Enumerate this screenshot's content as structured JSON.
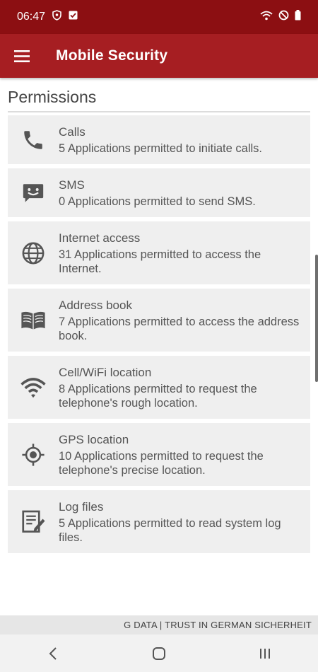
{
  "status_bar": {
    "time": "06:47",
    "icons": [
      "shield-icon",
      "checkbox-icon",
      "wifi-icon",
      "do-not-disturb-icon",
      "battery-icon"
    ]
  },
  "app_bar": {
    "title": "Mobile Security",
    "menu_icon": "hamburger-menu-icon"
  },
  "section": {
    "title": "Permissions"
  },
  "permissions": [
    {
      "icon": "phone-icon",
      "title": "Calls",
      "description": "5 Applications permitted to initiate calls."
    },
    {
      "icon": "sms-icon",
      "title": "SMS",
      "description": "0 Applications permitted to send SMS."
    },
    {
      "icon": "globe-icon",
      "title": "Internet access",
      "description": "31 Applications permitted to access the Internet."
    },
    {
      "icon": "book-icon",
      "title": "Address book",
      "description": "7 Applications permitted to access the address book."
    },
    {
      "icon": "wifi-icon",
      "title": "Cell/WiFi location",
      "description": "8 Applications permitted to request the telephone's rough location."
    },
    {
      "icon": "gps-target-icon",
      "title": "GPS location",
      "description": "10 Applications permitted to request the telephone's precise location."
    },
    {
      "icon": "log-file-icon",
      "title": "Log files",
      "description": "5 Applications permitted to read system log files."
    }
  ],
  "footer": {
    "text": "G DATA | TRUST IN GERMAN SICHERHEIT"
  },
  "nav_bar": {
    "buttons": [
      "back-icon",
      "home-icon",
      "recents-icon"
    ]
  },
  "colors": {
    "status_bar": "#8c0f12",
    "app_bar": "#a61e22",
    "card_background": "#efefef",
    "icon": "#555555"
  }
}
